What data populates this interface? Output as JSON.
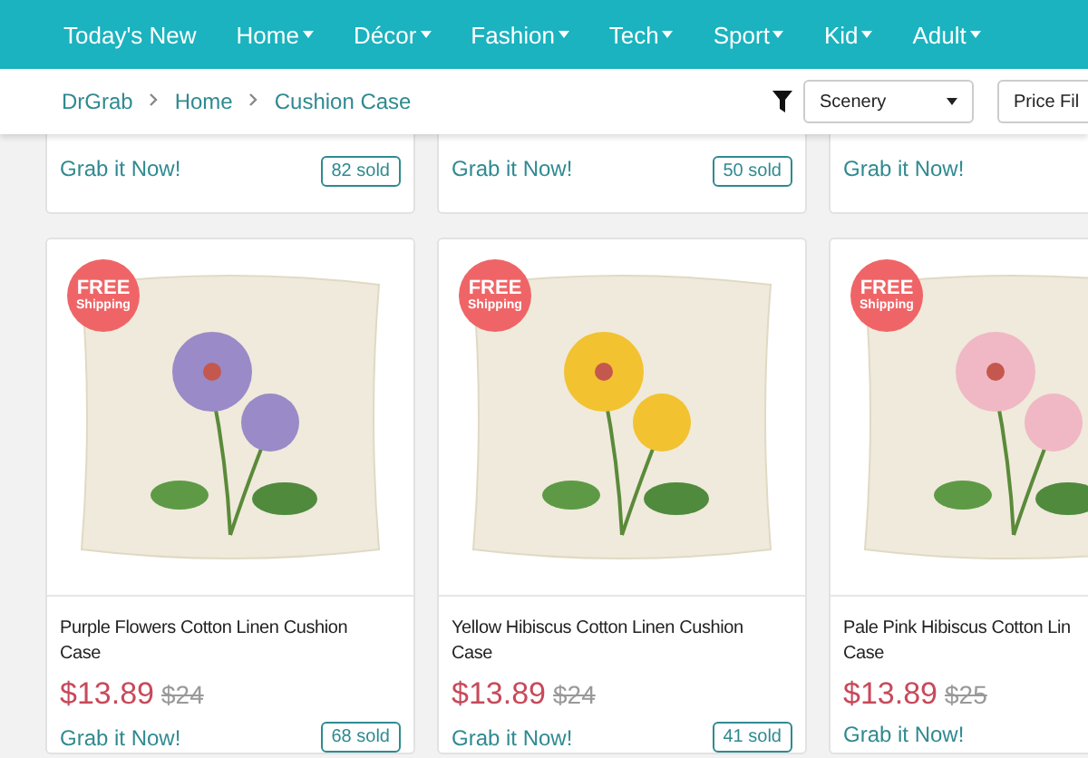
{
  "nav": {
    "items": [
      {
        "label": "Today's New",
        "dropdown": false
      },
      {
        "label": "Home",
        "dropdown": true
      },
      {
        "label": "Décor",
        "dropdown": true
      },
      {
        "label": "Fashion",
        "dropdown": true
      },
      {
        "label": "Tech",
        "dropdown": true
      },
      {
        "label": "Sport",
        "dropdown": true
      },
      {
        "label": "Kid",
        "dropdown": true
      },
      {
        "label": "Adult",
        "dropdown": true
      }
    ]
  },
  "breadcrumb": [
    "DrGrab",
    "Home",
    "Cushion Case"
  ],
  "filters": {
    "category": "Scenery",
    "price": "Price Fil"
  },
  "top_row": [
    {
      "action": "Grab it Now!",
      "sold": "82 sold"
    },
    {
      "action": "Grab it Now!",
      "sold": "50 sold"
    },
    {
      "action": "Grab it Now!"
    }
  ],
  "products": [
    {
      "badge": [
        "FREE",
        "Shipping"
      ],
      "color": "#9a8ac8",
      "title": [
        "Purple Flowers Cotton Linen Cushion",
        "Case"
      ],
      "price": "$13.89",
      "old_price": "$24",
      "action": "Grab it Now!",
      "sold": "68 sold"
    },
    {
      "badge": [
        "FREE",
        "Shipping"
      ],
      "color": "#f2c230",
      "title": [
        "Yellow Hibiscus Cotton Linen Cushion",
        "Case"
      ],
      "price": "$13.89",
      "old_price": "$24",
      "action": "Grab it Now!",
      "sold": "41 sold"
    },
    {
      "badge": [
        "FREE",
        "Shipping"
      ],
      "color": "#f0b8c4",
      "title": [
        "Pale Pink Hibiscus Cotton Lin",
        "Case"
      ],
      "price": "$13.89",
      "old_price": "$25",
      "action": "Grab it Now!"
    }
  ]
}
